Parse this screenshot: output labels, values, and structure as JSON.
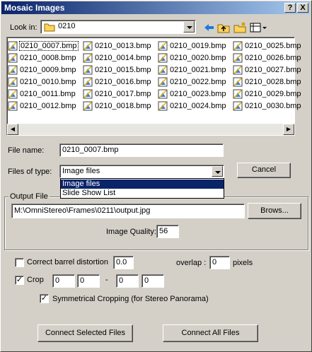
{
  "window": {
    "title": "Mosaic Images"
  },
  "caption_buttons": {
    "help": "?",
    "close": "X"
  },
  "lookin": {
    "label": "Look in:",
    "folder": "0210"
  },
  "files": [
    [
      "0210_0007.bmp",
      "0210_0008.bmp",
      "0210_0009.bmp",
      "0210_0010.bmp",
      "0210_0011.bmp",
      "0210_0012.bmp"
    ],
    [
      "0210_0013.bmp",
      "0210_0014.bmp",
      "0210_0015.bmp",
      "0210_0016.bmp",
      "0210_0017.bmp",
      "0210_0018.bmp"
    ],
    [
      "0210_0019.bmp",
      "0210_0020.bmp",
      "0210_0021.bmp",
      "0210_0022.bmp",
      "0210_0023.bmp",
      "0210_0024.bmp"
    ],
    [
      "0210_0025.bmp",
      "0210_0026.bmp",
      "0210_0027.bmp",
      "0210_0028.bmp",
      "0210_0029.bmp",
      "0210_0030.bmp"
    ]
  ],
  "selected_file": "0210_0007.bmp",
  "filename": {
    "label": "File name:",
    "value": "0210_0007.bmp"
  },
  "filetype": {
    "label": "Files of type:",
    "value": "Image files",
    "options": [
      "Image files",
      "Slide Show List"
    ]
  },
  "cancel_label": "Cancel",
  "output": {
    "group_label": "Output File",
    "path": "M:\\OmniStereo\\Frames\\0211\\output.jpg",
    "browse_label": "Brows...",
    "quality_label": "Image Quality:",
    "quality_value": "56"
  },
  "barrel": {
    "label": "Correct barrel distortion",
    "checked": false,
    "value": "0.0"
  },
  "overlap": {
    "label": "overlap :",
    "value": "0",
    "unit": "pixels"
  },
  "crop": {
    "label": "Crop",
    "checked": true,
    "v1": "0",
    "v2": "0",
    "dash": "-",
    "v3": "0",
    "v4": "0"
  },
  "symmetric": {
    "label": "Symmetrical Cropping (for Stereo Panorama)",
    "checked": true
  },
  "buttons": {
    "connect_selected": "Connect Selected Files",
    "connect_all": "Connect All Files"
  }
}
